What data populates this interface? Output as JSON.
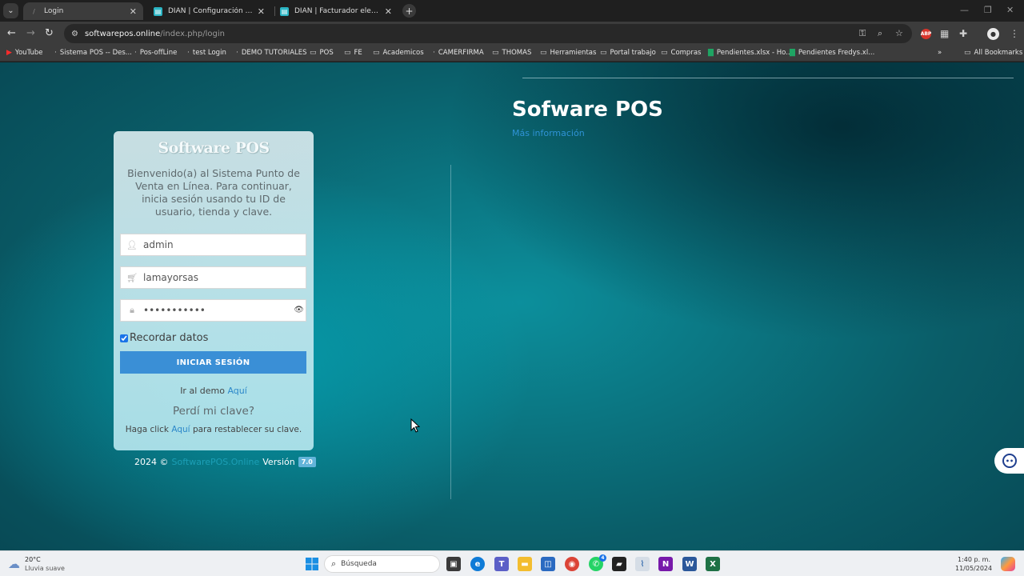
{
  "browser": {
    "tabs": [
      {
        "title": "Login",
        "active": true
      },
      {
        "title": "DIAN | Configuración / Gestion...",
        "active": false
      },
      {
        "title": "DIAN | Facturador electrónico",
        "active": false
      }
    ],
    "url": {
      "host": "softwarepos.online",
      "path": "/index.php/login"
    },
    "bookmarks": [
      {
        "label": "YouTube",
        "icon": "youtube-icon"
      },
      {
        "label": "Sistema POS -- Des...",
        "icon": "page-icon"
      },
      {
        "label": "Pos-offLine",
        "icon": "page-icon"
      },
      {
        "label": "test Login",
        "icon": "page-icon"
      },
      {
        "label": "DEMO TUTORIALES",
        "icon": "page-icon"
      },
      {
        "label": "POS",
        "icon": "folder-icon"
      },
      {
        "label": "FE",
        "icon": "folder-icon"
      },
      {
        "label": "Academicos",
        "icon": "folder-icon"
      },
      {
        "label": "CAMERFIRMA",
        "icon": "page-icon"
      },
      {
        "label": "THOMAS",
        "icon": "folder-icon"
      },
      {
        "label": "Herramientas",
        "icon": "folder-icon"
      },
      {
        "label": "Portal trabajo",
        "icon": "folder-icon"
      },
      {
        "label": "Compras",
        "icon": "folder-icon"
      },
      {
        "label": "Pendientes.xlsx - Ho...",
        "icon": "sheets-icon"
      },
      {
        "label": "Pendientes Fredys.xl...",
        "icon": "sheets-icon"
      }
    ],
    "all_bookmarks": "All Bookmarks"
  },
  "page": {
    "hero_title": "Sofware POS",
    "hero_link": "Más información",
    "login": {
      "logo": "Software POS",
      "welcome": "Bienvenido(a) al Sistema Punto de Venta en Línea. Para continuar, inicia sesión usando tu ID de usuario, tienda y clave.",
      "user_value": "admin",
      "store_value": "lamayorsas",
      "password_value": "lamayorsas1",
      "remember_label": "Recordar datos",
      "remember_checked": true,
      "button_label": "INICIAR SESIÓN",
      "demo_prefix": "Ir al demo",
      "demo_link": "Aquí",
      "lost_password": "Perdí mi clave?",
      "reset_prefix": "Haga click",
      "reset_link": "Aquí",
      "reset_suffix": "para restablecer su clave."
    },
    "footer": {
      "year": "2024 ©",
      "brand": "SoftwarePOS.Online",
      "version_label": "Versión",
      "version": "7.0"
    }
  },
  "taskbar": {
    "weather_temp": "20°C",
    "weather_desc": "Lluvia suave",
    "search_placeholder": "Búsqueda",
    "whatsapp_badge": "4",
    "time": "1:40 p. m.",
    "date": "11/05/2024"
  },
  "colors": {
    "accent": "#3a8fd6",
    "link": "#2b87c9",
    "teal_bg": "#0c8f9c"
  }
}
